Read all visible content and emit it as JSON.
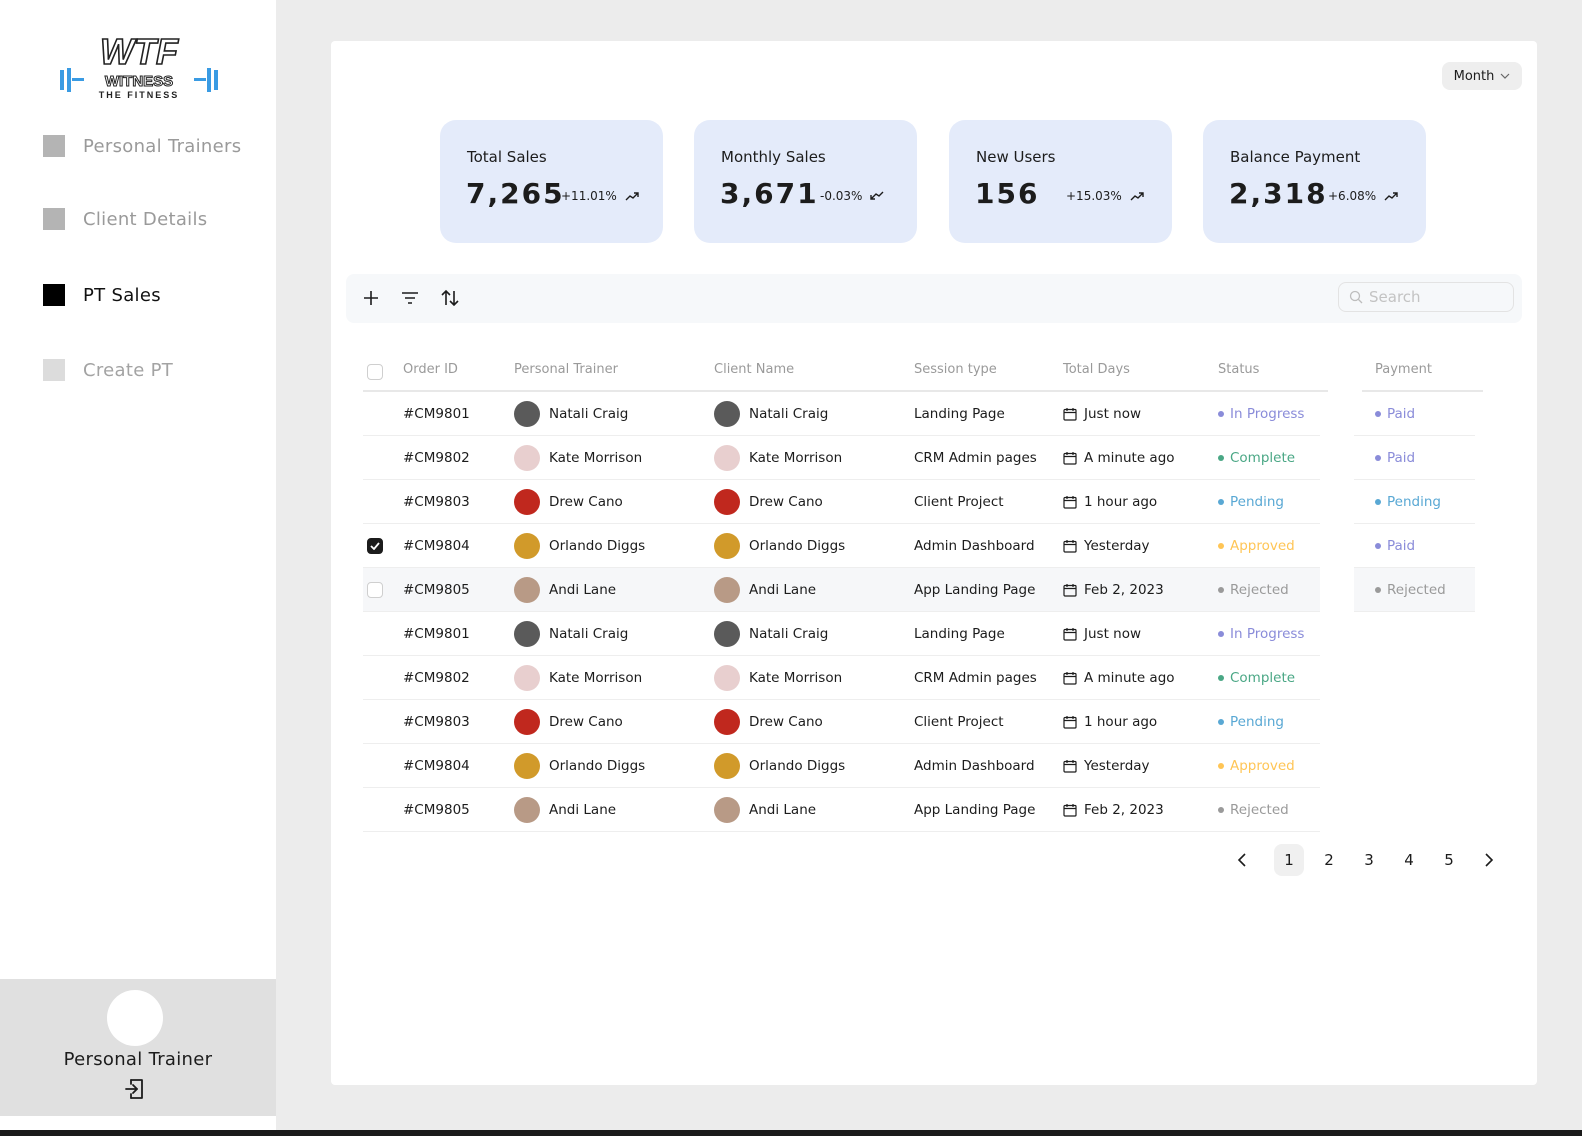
{
  "brand": {
    "logo_main": "WTF",
    "logo_sub": "WITNESS",
    "logo_tag": "THE FITNESS",
    "accent": "#3a9be3"
  },
  "sidebar": {
    "items": [
      {
        "label": "Personal Trainers",
        "color": "#b4b4b4",
        "text_color": "#9a9a9a"
      },
      {
        "label": "Client Details",
        "color": "#b4b4b4",
        "text_color": "#9a9a9a"
      },
      {
        "label": "PT Sales",
        "color": "#000000",
        "text_color": "#111111"
      },
      {
        "label": "Create PT",
        "color": "#dcdcdc",
        "text_color": "#a3a3a3"
      }
    ],
    "profile": {
      "name": "Personal Trainer",
      "logout_icon": "logout-icon"
    }
  },
  "header": {
    "period": "Month"
  },
  "stats": [
    {
      "title": "Total Sales",
      "value": "7,265",
      "change": "+11.01%",
      "trend": "up"
    },
    {
      "title": "Monthly Sales",
      "value": "3,671",
      "change": "-0.03%",
      "trend": "down"
    },
    {
      "title": "New Users",
      "value": "156",
      "change": "+15.03%",
      "trend": "up"
    },
    {
      "title": "Balance Payment",
      "value": "2,318",
      "change": "+6.08%",
      "trend": "up"
    }
  ],
  "toolbar": {
    "search_placeholder": "Search"
  },
  "table": {
    "columns": [
      "Order ID",
      "Personal Trainer",
      "Client Name",
      "Session type",
      "Total Days",
      "Status",
      "Payment"
    ],
    "status_colors": {
      "In Progress": "#8a8cd9",
      "Complete": "#4aa785",
      "Pending": "#59a8d4",
      "Approved": "#ffc555",
      "Rejected": "#9a9a9a",
      "Paid": "#8a8cd9"
    },
    "rows": [
      {
        "order_id": "#CM9801",
        "trainer": "Natali Craig",
        "client": "Natali Craig",
        "session": "Landing Page",
        "days": "Just now",
        "status": "In Progress",
        "payment": "Paid",
        "avatar_color": "#5a5a5a"
      },
      {
        "order_id": "#CM9802",
        "trainer": "Kate Morrison",
        "client": "Kate Morrison",
        "session": "CRM Admin pages",
        "days": "A minute ago",
        "status": "Complete",
        "payment": "Paid",
        "avatar_color": "#e8cfcf"
      },
      {
        "order_id": "#CM9803",
        "trainer": "Drew Cano",
        "client": "Drew Cano",
        "session": "Client Project",
        "days": "1 hour ago",
        "status": "Pending",
        "payment": "Pending",
        "avatar_color": "#c0281e"
      },
      {
        "order_id": "#CM9804",
        "trainer": "Orlando Diggs",
        "client": "Orlando Diggs",
        "session": "Admin Dashboard",
        "days": "Yesterday",
        "status": "Approved",
        "payment": "Paid",
        "avatar_color": "#d19a2a"
      },
      {
        "order_id": "#CM9805",
        "trainer": "Andi Lane",
        "client": "Andi Lane",
        "session": "App Landing Page",
        "days": "Feb 2, 2023",
        "status": "Rejected",
        "payment": "Rejected",
        "avatar_color": "#b89a86"
      },
      {
        "order_id": "#CM9801",
        "trainer": "Natali Craig",
        "client": "Natali Craig",
        "session": "Landing Page",
        "days": "Just now",
        "status": "In Progress",
        "payment": "",
        "avatar_color": "#5a5a5a"
      },
      {
        "order_id": "#CM9802",
        "trainer": "Kate Morrison",
        "client": "Kate Morrison",
        "session": "CRM Admin pages",
        "days": "A minute ago",
        "status": "Complete",
        "payment": "",
        "avatar_color": "#e8cfcf"
      },
      {
        "order_id": "#CM9803",
        "trainer": "Drew Cano",
        "client": "Drew Cano",
        "session": "Client Project",
        "days": "1 hour ago",
        "status": "Pending",
        "payment": "",
        "avatar_color": "#c0281e"
      },
      {
        "order_id": "#CM9804",
        "trainer": "Orlando Diggs",
        "client": "Orlando Diggs",
        "session": "Admin Dashboard",
        "days": "Yesterday",
        "status": "Approved",
        "payment": "",
        "avatar_color": "#d19a2a"
      },
      {
        "order_id": "#CM9805",
        "trainer": "Andi Lane",
        "client": "Andi Lane",
        "session": "App Landing Page",
        "days": "Feb 2, 2023",
        "status": "Rejected",
        "payment": "",
        "avatar_color": "#b89a86"
      }
    ],
    "checked_row": 3,
    "unchecked_row": 4
  },
  "pagination": {
    "pages": [
      "1",
      "2",
      "3",
      "4",
      "5"
    ],
    "current": "1"
  }
}
